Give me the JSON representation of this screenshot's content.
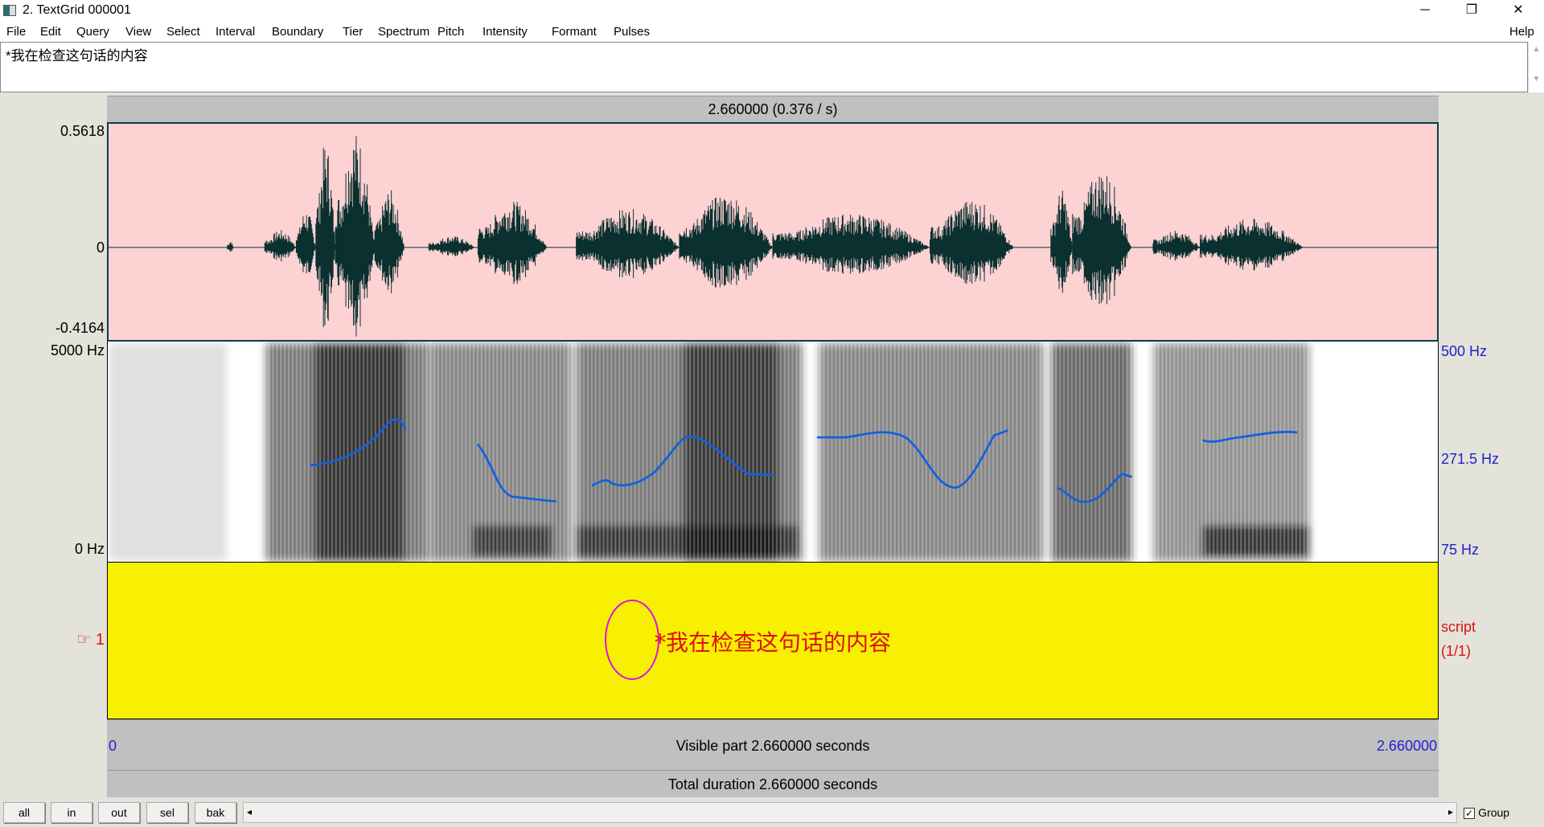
{
  "window": {
    "title": "2. TextGrid 000001",
    "controls": [
      "─",
      "❐",
      "✕"
    ]
  },
  "menu": {
    "items": [
      "File",
      "Edit",
      "Query",
      "View",
      "Select",
      "Interval",
      "Boundary",
      "Tier",
      "Spectrum",
      "Pitch",
      "Intensity",
      "Formant",
      "Pulses"
    ],
    "help": "Help"
  },
  "text_editor": {
    "value": "*我在检查这句话的内容"
  },
  "selection_bar": "2.660000 (0.376 / s)",
  "waveform": {
    "max": "0.5618",
    "zero": "0",
    "min": "-0.4164"
  },
  "spectrogram": {
    "top": "5000 Hz",
    "bottom": "0 Hz"
  },
  "pitch": {
    "top": "500 Hz",
    "mid": "271.5 Hz",
    "bottom": "75 Hz",
    "color": "#1060e0"
  },
  "tier": {
    "number": "1",
    "pointer": "☞",
    "interval_text": "*我在检查这句话的内容",
    "name": "script",
    "count": "(1/1)"
  },
  "time": {
    "start": "0",
    "end": "2.660000",
    "visible": "Visible part 2.660000 seconds",
    "total": "Total duration 2.660000 seconds"
  },
  "buttons": [
    "all",
    "in",
    "out",
    "sel",
    "bak"
  ],
  "group": {
    "label": "Group",
    "checked": true
  }
}
